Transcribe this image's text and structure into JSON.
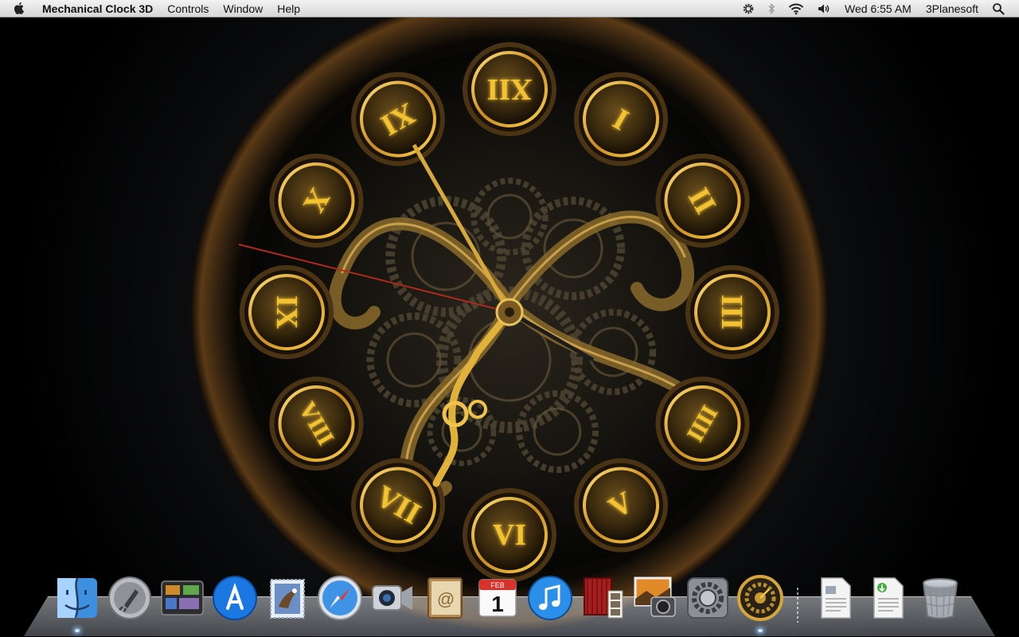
{
  "menubar": {
    "apple_icon": "apple-logo-icon",
    "app_name": "Mechanical Clock 3D",
    "menus": [
      "Controls",
      "Window",
      "Help"
    ],
    "status_icons": [
      "gear-icon",
      "bluetooth-icon",
      "wifi-icon",
      "volume-icon"
    ],
    "clock": "Wed 6:55 AM",
    "user": "3Planesoft",
    "spotlight_icon": "search-icon"
  },
  "clock": {
    "numerals": [
      "XII",
      "I",
      "II",
      "III",
      "IIII",
      "V",
      "VI",
      "VII",
      "VIII",
      "IX",
      "X",
      "XI"
    ],
    "hour_hand_time": "6:55",
    "colors": {
      "gold": "#f2c230",
      "bronze": "#7a5a22",
      "gear": "#4a4130",
      "background": "#000000"
    }
  },
  "dock": {
    "apps": [
      {
        "name": "Finder",
        "icon": "finder-icon",
        "running": true
      },
      {
        "name": "Launchpad",
        "icon": "rocket-icon",
        "running": false
      },
      {
        "name": "Mission Control",
        "icon": "mission-control-icon",
        "running": false
      },
      {
        "name": "App Store",
        "icon": "app-store-icon",
        "running": false
      },
      {
        "name": "Mail",
        "icon": "mail-stamp-icon",
        "running": false
      },
      {
        "name": "Safari",
        "icon": "compass-icon",
        "running": false
      },
      {
        "name": "FaceTime",
        "icon": "video-camera-icon",
        "running": false
      },
      {
        "name": "Address Book",
        "icon": "contacts-book-icon",
        "running": false
      },
      {
        "name": "iCal",
        "icon": "calendar-icon",
        "running": false,
        "month": "FEB",
        "day": "1"
      },
      {
        "name": "iTunes",
        "icon": "music-note-icon",
        "running": false
      },
      {
        "name": "Photo Booth",
        "icon": "photo-booth-icon",
        "running": false
      },
      {
        "name": "iPhoto",
        "icon": "iphoto-icon",
        "running": false
      },
      {
        "name": "System Preferences",
        "icon": "system-preferences-icon",
        "running": false
      },
      {
        "name": "Mechanical Clock 3D",
        "icon": "clock-gear-icon",
        "running": true
      }
    ],
    "documents": [
      {
        "name": "Document",
        "icon": "document-icon"
      },
      {
        "name": "Installer",
        "icon": "installer-document-icon"
      },
      {
        "name": "Trash",
        "icon": "trash-icon"
      }
    ]
  }
}
